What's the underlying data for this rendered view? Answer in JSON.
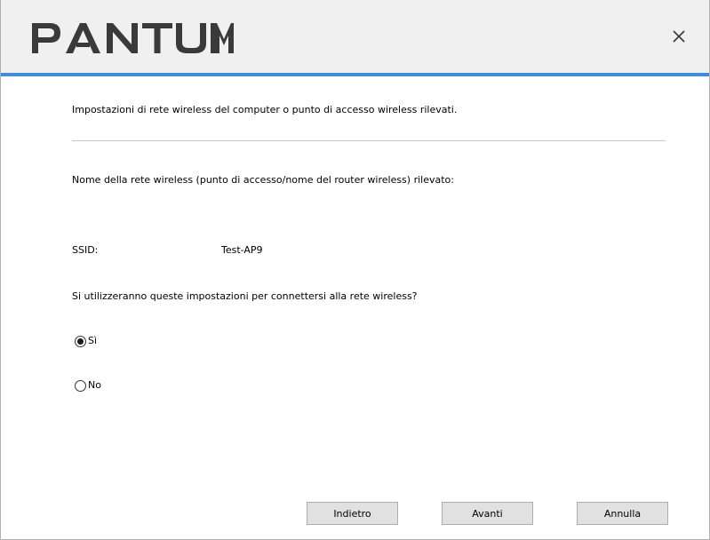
{
  "titlebar": {
    "logo_text": "PANTUM",
    "close_label": "×"
  },
  "content": {
    "intro_text": "Impostazioni di rete wireless del computer o punto di accesso wireless rilevati.",
    "network_name_label": "Nome della rete wireless (punto di accesso/nome del router wireless) rilevato:",
    "ssid_label": "SSID:",
    "ssid_value": "Test-AP9",
    "question_text": "Si utilizzeranno queste impostazioni per connettersi alla rete wireless?",
    "options": [
      {
        "label": "Sì",
        "selected": true
      },
      {
        "label": "No",
        "selected": false
      }
    ]
  },
  "buttons": {
    "back_label": "Indietro",
    "next_label": "Avanti",
    "cancel_label": "Annulla"
  },
  "colors": {
    "accent_line": "#3d8de0",
    "logo": "#3a3a3a",
    "titlebar_bg": "#f0f0f0"
  }
}
